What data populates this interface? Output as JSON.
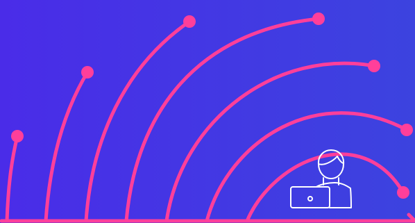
{
  "colors": {
    "background_start": "#4a2ce8",
    "background_end": "#3c43df",
    "accent": "#ff3f9a",
    "icon": "#ffffff"
  },
  "icons": {
    "main_icon": "person-at-laptop-icon"
  }
}
